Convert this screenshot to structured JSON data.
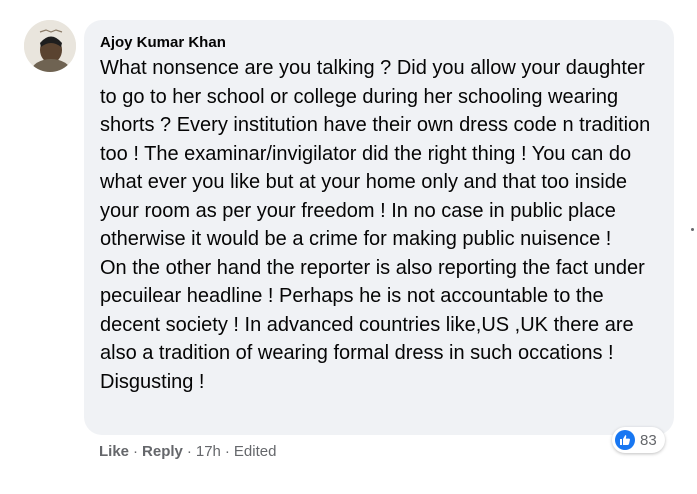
{
  "comment": {
    "author": "Ajoy Kumar Khan",
    "paragraphs": [
      "What nonsence are you talking ? Did you allow your daughter to go to her school or college during her schooling wearing shorts ? Every institution have their own dress code n tradition too ! The examinar/invigilator did the right thing ! You can do what ever you like but at your home only and that too inside your room as per your freedom ! In no case in public place otherwise it would be a crime for making public nuisence !",
      "On the other hand the reporter is also reporting the fact under pecuilear headline ! Perhaps he is not accountable to the decent society ! In advanced countries like,US ,UK there are also a tradition of wearing formal dress in such occations ! Disgusting !"
    ],
    "reaction_count": "83",
    "actions": {
      "like": "Like",
      "reply": "Reply",
      "time": "17h",
      "edited": "Edited",
      "separator": "·"
    }
  },
  "icons": {
    "avatar": "profile-photo",
    "reaction": "like-thumb-icon",
    "menu": "more-options-icon"
  },
  "colors": {
    "bubble": "#f0f2f5",
    "text": "#050505",
    "meta": "#65676b",
    "like_blue": "#1877f2"
  }
}
